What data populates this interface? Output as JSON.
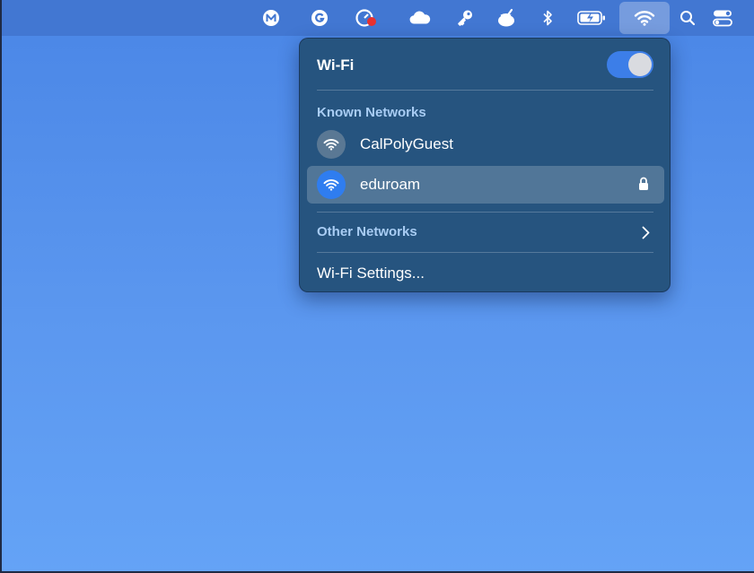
{
  "menubar": {
    "icons": [
      "m-app-icon",
      "grammarly-icon",
      "speedtest-icon",
      "cloud-icon",
      "key-icon",
      "paint-bucket-icon",
      "bluetooth-icon",
      "battery-charging-icon",
      "wifi-icon",
      "search-icon",
      "control-center-icon"
    ]
  },
  "wifi_menu": {
    "title": "Wi-Fi",
    "enabled": true,
    "known_label": "Known Networks",
    "known_networks": [
      {
        "name": "CalPolyGuest",
        "secured": false,
        "connected": false
      },
      {
        "name": "eduroam",
        "secured": true,
        "connected": true
      }
    ],
    "other_label": "Other Networks",
    "settings_label": "Wi-Fi Settings..."
  },
  "colors": {
    "desktop": "#5b97ef",
    "menubar": "#4277d2",
    "panel": "#26547f",
    "accent": "#2f7df0",
    "section_label": "#a9cdf4"
  }
}
